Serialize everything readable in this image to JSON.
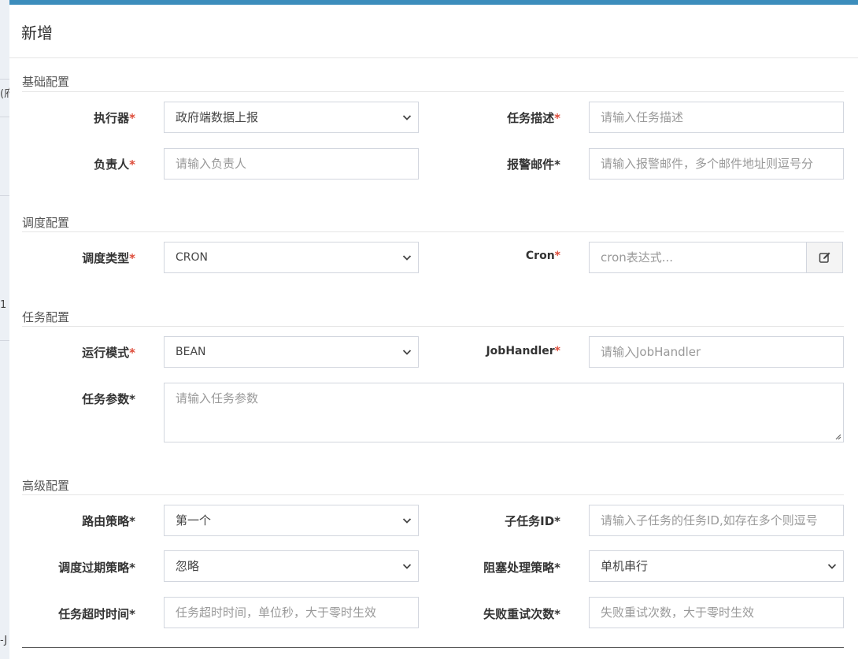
{
  "modal": {
    "title": "新增"
  },
  "background": {
    "fragment_1": "(府",
    "fragment_2": "1",
    "fragment_3": "-J"
  },
  "sections": {
    "basic": "基础配置",
    "schedule": "调度配置",
    "task": "任务配置",
    "advanced": "高级配置"
  },
  "fields": {
    "executor": {
      "label": "执行器",
      "required": "*",
      "value": "政府端数据上报"
    },
    "job_desc": {
      "label": "任务描述",
      "required": "*",
      "placeholder": "请输入任务描述"
    },
    "author": {
      "label": "负责人",
      "required": "*",
      "placeholder": "请输入负责人"
    },
    "alarm_email": {
      "label": "报警邮件*",
      "placeholder": "请输入报警邮件，多个邮件地址则逗号分"
    },
    "schedule_type": {
      "label": "调度类型",
      "required": "*",
      "value": "CRON"
    },
    "cron": {
      "label": "Cron",
      "required": "*",
      "placeholder": "cron表达式..."
    },
    "glue_type": {
      "label": "运行模式",
      "required": "*",
      "value": "BEAN"
    },
    "job_handler": {
      "label": "JobHandler",
      "required": "*",
      "placeholder": "请输入JobHandler"
    },
    "job_param": {
      "label": "任务参数*",
      "placeholder": "请输入任务参数"
    },
    "route_strategy": {
      "label": "路由策略*",
      "value": "第一个"
    },
    "child_job_id": {
      "label": "子任务ID*",
      "placeholder": "请输入子任务的任务ID,如存在多个则逗号"
    },
    "misfire_strategy": {
      "label": "调度过期策略*",
      "value": "忽略"
    },
    "block_strategy": {
      "label": "阻塞处理策略*",
      "value": "单机串行"
    },
    "timeout": {
      "label": "任务超时时间*",
      "placeholder": "任务超时时间，单位秒，大于零时生效"
    },
    "fail_retry": {
      "label": "失败重试次数*",
      "placeholder": "失败重试次数，大于零时生效"
    }
  },
  "icons": {
    "chevron": "chevron-down-icon",
    "cron_edit": "edit-icon",
    "resize": "resize-grip-icon"
  },
  "colors": {
    "required": "#dd4b39",
    "top_bar": "#3c8dbc"
  }
}
